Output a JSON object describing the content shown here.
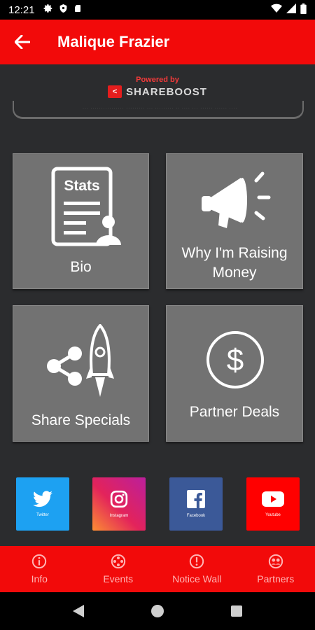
{
  "status_bar": {
    "time": "12:21"
  },
  "app_bar": {
    "title": "Malique Frazier"
  },
  "banner": {
    "powered_by": "Powered by",
    "brand_name": "SHAREBOOST",
    "brand_logo": "<",
    "fine_print": "··· ················ ·········        ··· ········· ·· ···· ···   ······   ······   ····"
  },
  "tiles": {
    "bio": {
      "label": "Bio",
      "icon_text": "Stats"
    },
    "why": {
      "label_line1": "Why I'm Raising",
      "label_line2": "Money"
    },
    "share": {
      "label": "Share Specials"
    },
    "partner": {
      "label": "Partner Deals"
    }
  },
  "social": {
    "twitter": "Twitter",
    "instagram": "Instagram",
    "facebook": "Facebook",
    "youtube": "Youtube"
  },
  "bottom_nav": {
    "info": "Info",
    "events": "Events",
    "notice_wall": "Notice Wall",
    "partners": "Partners"
  },
  "colors": {
    "accent": "#f20a0a",
    "tile": "#727272",
    "background": "#2b2c2e"
  }
}
